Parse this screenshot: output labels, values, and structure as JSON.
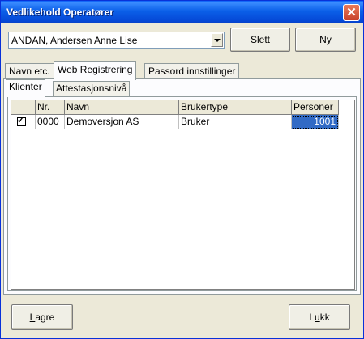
{
  "window": {
    "title": "Vedlikehold Operatører",
    "close_glyph": "✕"
  },
  "operator_select": {
    "value": "ANDAN, Andersen Anne Lise"
  },
  "toolbar": {
    "delete_label_u": "S",
    "delete_label_rest": "lett",
    "new_label_u": "N",
    "new_label_rest": "y"
  },
  "tabs": [
    {
      "label": "Navn etc."
    },
    {
      "label": "Web Registrering"
    },
    {
      "label": "Passord innstillinger"
    }
  ],
  "subtabs": [
    {
      "label": "Klienter"
    },
    {
      "label": "Attestasjonsnivå"
    }
  ],
  "grid": {
    "columns": [
      "",
      "Nr.",
      "Navn",
      "Brukertype",
      "Personer"
    ],
    "rows": [
      {
        "checked": "✓",
        "nr": "0000",
        "navn": "Demoversjon AS",
        "brukertype": "Bruker",
        "personer": "1001"
      }
    ]
  },
  "footer": {
    "save_label_u": "L",
    "save_label_rest": "agre",
    "close_label_pre": "L",
    "close_label_u": "u",
    "close_label_rest": "kk"
  }
}
